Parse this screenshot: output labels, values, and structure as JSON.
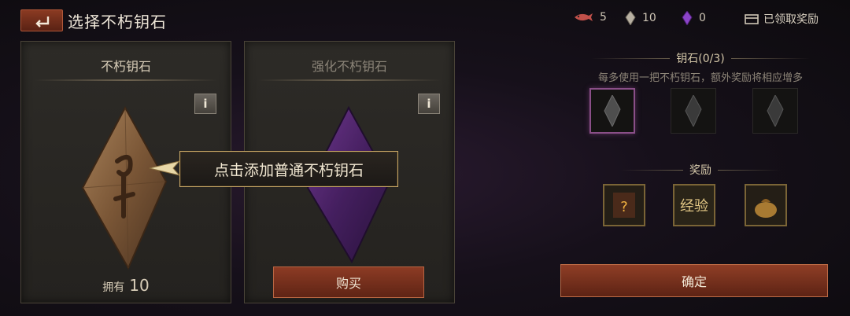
{
  "header": {
    "title": "选择不朽钥石"
  },
  "currencies": [
    {
      "icon": "fish-icon",
      "value": "5"
    },
    {
      "icon": "gray-crystal-icon",
      "value": "10"
    },
    {
      "icon": "purple-crystal-icon",
      "value": "0"
    }
  ],
  "claimed_label": "已领取奖励",
  "cards": [
    {
      "title": "不朽钥石",
      "info": "i",
      "owned_label": "拥有",
      "owned_count": "10"
    },
    {
      "title": "强化不朽钥石",
      "info": "i",
      "buy_label": "购买"
    }
  ],
  "tooltip": "点击添加普通不朽钥石",
  "keys_panel": {
    "header": "钥石(0/3)",
    "hint": "每多使用一把不朽钥石，额外奖励将相应增多",
    "slots": 3
  },
  "rewards_panel": {
    "header": "奖励",
    "items": [
      {
        "icon": "mystery-item-icon"
      },
      {
        "label": "经验"
      },
      {
        "icon": "gold-bag-icon"
      }
    ]
  },
  "confirm_label": "确定",
  "colors": {
    "accent": "#8c3b24",
    "gold_border": "#c9a866",
    "purple": "#6a2a8a"
  }
}
